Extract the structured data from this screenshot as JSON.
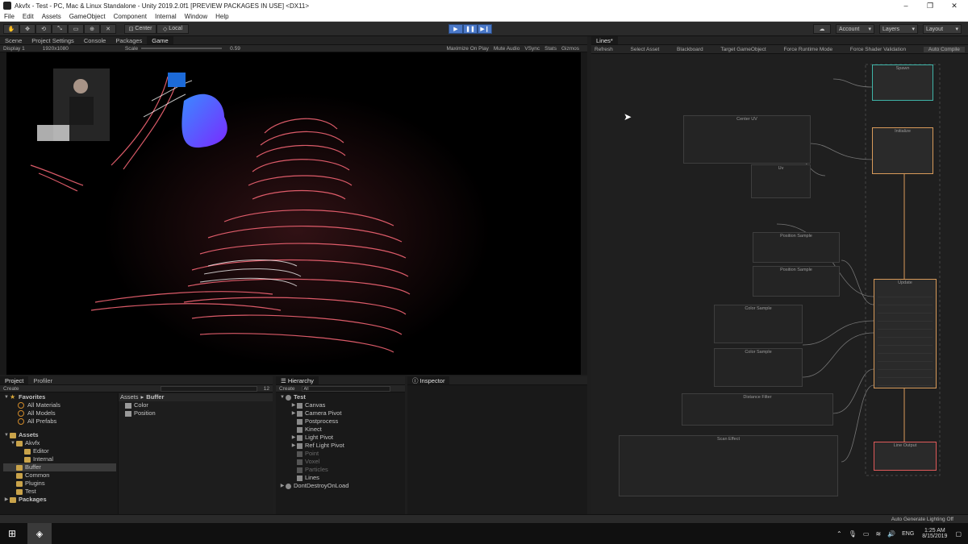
{
  "window": {
    "title": "Akvfx - Test - PC, Mac & Linux Standalone - Unity 2019.2.0f1 [PREVIEW PACKAGES IN USE] <DX11>",
    "min": "–",
    "max": "❐",
    "close": "✕"
  },
  "menu": [
    "File",
    "Edit",
    "Assets",
    "GameObject",
    "Component",
    "Internal",
    "Window",
    "Help"
  ],
  "toolbar": {
    "pivot": "Center",
    "space": "Local",
    "account": "Account",
    "layers": "Layers",
    "layout": "Layout"
  },
  "scene_tabs": [
    "Scene",
    "Project Settings",
    "Console",
    "Packages",
    "Game"
  ],
  "game_bar": {
    "display": "Display 1",
    "resolution": "1920x1080",
    "scale_label": "Scale",
    "scale_value": "0.59",
    "maximize": "Maximize On Play",
    "mute": "Mute Audio",
    "vsync": "VSync",
    "stats": "Stats",
    "gizmos": "Gizmos"
  },
  "project": {
    "tabs": [
      "Project",
      "Profiler"
    ],
    "create": "Create",
    "count": "12",
    "favorites_label": "Favorites",
    "favorites": [
      "All Materials",
      "All Models",
      "All Prefabs"
    ],
    "assets_label": "Assets",
    "tree": [
      {
        "label": "Akvfx",
        "depth": 1
      },
      {
        "label": "Editor",
        "depth": 2
      },
      {
        "label": "Internal",
        "depth": 2
      },
      {
        "label": "Buffer",
        "depth": 1
      },
      {
        "label": "Common",
        "depth": 1
      },
      {
        "label": "Plugins",
        "depth": 1
      },
      {
        "label": "Test",
        "depth": 1
      }
    ],
    "packages_label": "Packages",
    "breadcrumb_root": "Assets",
    "breadcrumb_leaf": "Buffer",
    "files": [
      "Color",
      "Position"
    ]
  },
  "hierarchy": {
    "tab": "Hierarchy",
    "create": "Create",
    "search": "All",
    "scene": "Test",
    "items": [
      {
        "label": "Canvas",
        "arrow": true,
        "dim": false
      },
      {
        "label": "Camera Pivot",
        "arrow": true,
        "dim": false
      },
      {
        "label": "Postprocess",
        "arrow": false,
        "dim": false
      },
      {
        "label": "Kinect",
        "arrow": false,
        "dim": false
      },
      {
        "label": "Light Pivot",
        "arrow": true,
        "dim": false
      },
      {
        "label": "Ref Light Pivot",
        "arrow": true,
        "dim": false
      },
      {
        "label": "Point",
        "arrow": false,
        "dim": true
      },
      {
        "label": "Voxel",
        "arrow": false,
        "dim": true
      },
      {
        "label": "Particles",
        "arrow": false,
        "dim": true
      },
      {
        "label": "Lines",
        "arrow": false,
        "dim": false
      }
    ],
    "dontdestroy": "DontDestroyOnLoad"
  },
  "inspector": {
    "tab": "Inspector"
  },
  "vfx": {
    "tab": "Lines*",
    "buttons": [
      "Refresh",
      "Select Asset",
      "Blackboard",
      "Target GameObject",
      "Force Runtime Mode",
      "Force Shader Validation",
      "Auto Compile"
    ],
    "nodes": {
      "spawn": "Spawn",
      "center_uv": "Center UV",
      "uv": "Uv",
      "initialize": "Initialize",
      "position_sample1": "Position Sample",
      "position_sample2": "Position Sample",
      "color_sample1": "Color Sample",
      "color_sample2": "Color Sample",
      "update": "Update",
      "distance_filter": "Distance Filter",
      "scan_effect": "Scan Effect",
      "line_output": "Line Output"
    },
    "colors": {
      "spawn": "#3fb4a8",
      "initialize": "#d89a5a",
      "update": "#d89a5a",
      "output": "#e05a5a"
    }
  },
  "status": {
    "lighting": "Auto Generate Lighting Off"
  },
  "taskbar": {
    "lang": "ENG",
    "time": "1:25 AM",
    "date": "8/15/2019"
  }
}
